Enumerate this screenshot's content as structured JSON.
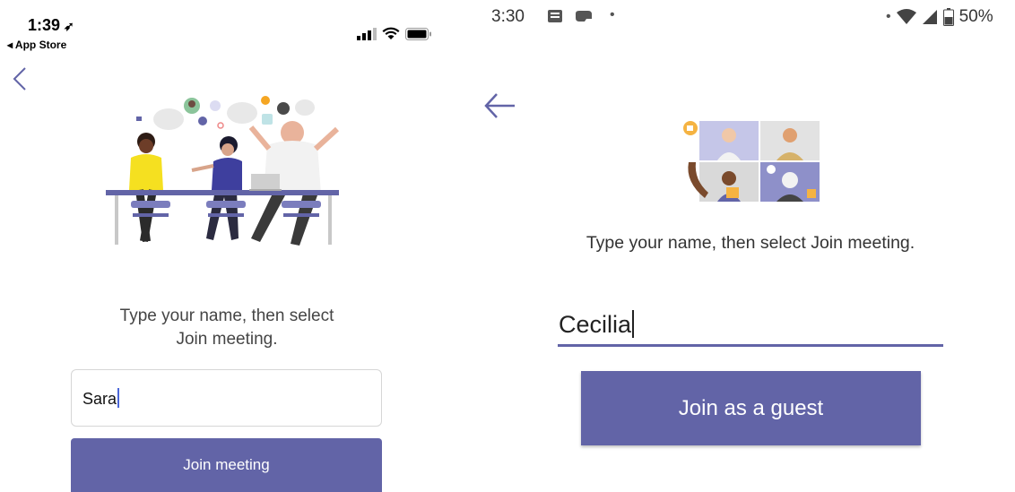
{
  "ios": {
    "status_bar": {
      "time": "1:39",
      "back_to_app": "◂ App Store"
    },
    "instruction_line1": "Type your name, then select",
    "instruction_line2": "Join meeting.",
    "name_input_value": "Sara",
    "join_button": "Join meeting",
    "accent": "#6264a7"
  },
  "android": {
    "status_bar": {
      "time": "3:30",
      "battery": "50%"
    },
    "instruction": "Type your name, then select Join meeting.",
    "name_input_value": "Cecilia",
    "join_button": "Join as a guest",
    "accent": "#6264a7"
  }
}
